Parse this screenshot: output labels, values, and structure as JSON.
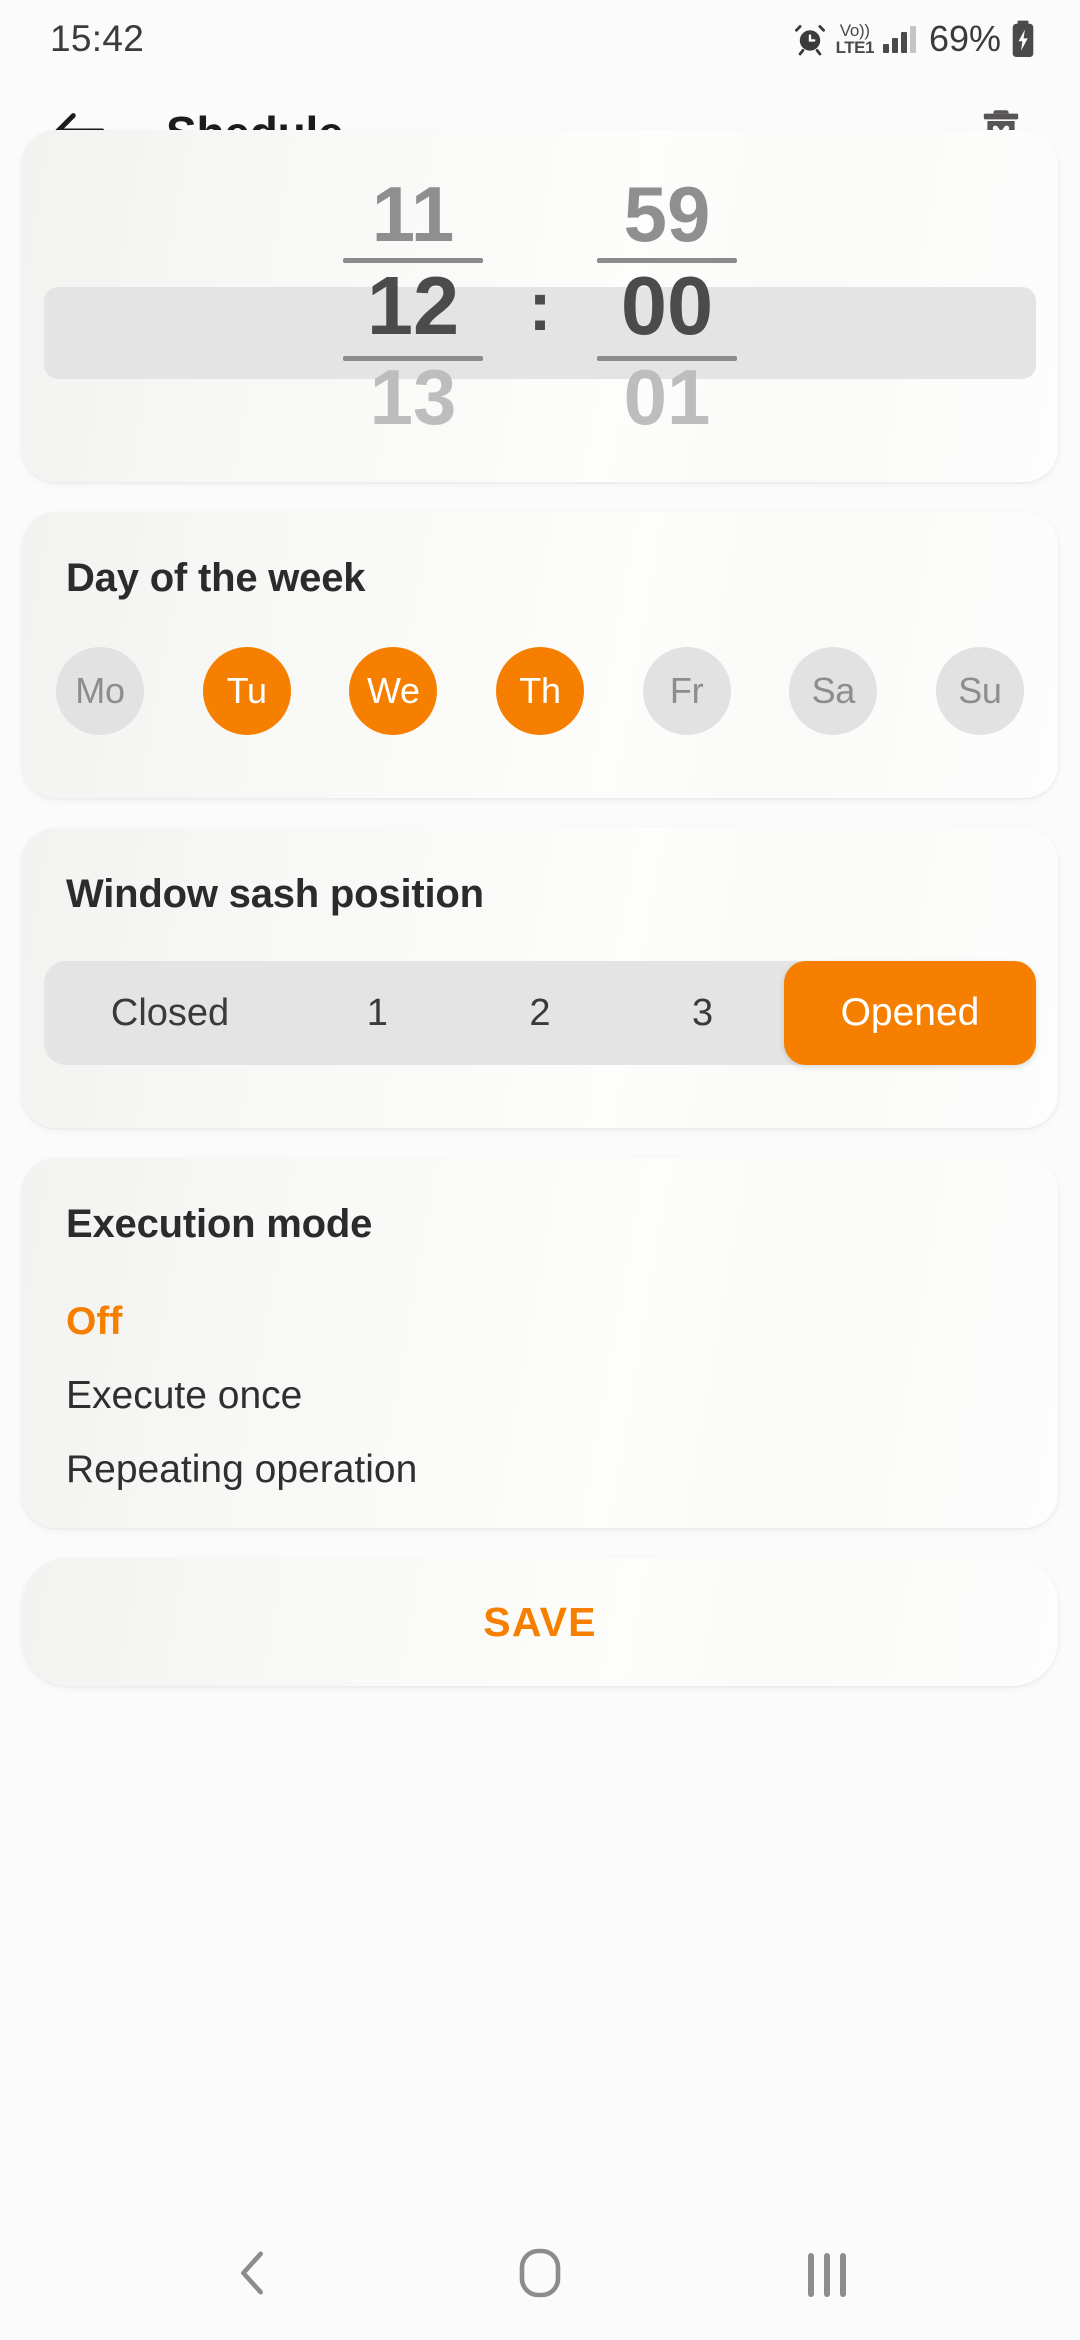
{
  "status_bar": {
    "time": "15:42",
    "alarm_icon": "alarm-clock-icon",
    "network": {
      "line1": "Vo))",
      "line2": "LTE1"
    },
    "signal_icon": "signal-bars-icon",
    "battery_percent": "69%",
    "battery_icon": "battery-charging-icon"
  },
  "app_bar": {
    "back_icon": "arrow-left-icon",
    "title": "Shedule",
    "delete_icon": "trash-delete-icon"
  },
  "time_picker": {
    "hour": {
      "prev": "11",
      "current": "12",
      "next": "13"
    },
    "separator": ":",
    "minute": {
      "prev": "59",
      "current": "00",
      "next": "01"
    }
  },
  "day_of_week": {
    "title": "Day of the week",
    "days": [
      {
        "label": "Mo",
        "selected": false
      },
      {
        "label": "Tu",
        "selected": true
      },
      {
        "label": "We",
        "selected": true
      },
      {
        "label": "Th",
        "selected": true
      },
      {
        "label": "Fr",
        "selected": false
      },
      {
        "label": "Sa",
        "selected": false
      },
      {
        "label": "Su",
        "selected": false
      }
    ]
  },
  "sash_position": {
    "title": "Window sash position",
    "options": [
      {
        "label": "Closed",
        "selected": false
      },
      {
        "label": "1",
        "selected": false
      },
      {
        "label": "2",
        "selected": false
      },
      {
        "label": "3",
        "selected": false
      },
      {
        "label": "Opened",
        "selected": true
      }
    ]
  },
  "execution_mode": {
    "title": "Execution mode",
    "options": [
      {
        "label": "Off",
        "selected": true
      },
      {
        "label": "Execute once",
        "selected": false
      },
      {
        "label": "Repeating operation",
        "selected": false
      }
    ]
  },
  "save_button": {
    "label": "SAVE"
  },
  "nav_bar": {
    "back_icon": "nav-back-icon",
    "home_icon": "nav-home-icon",
    "recents_icon": "nav-recents-icon"
  },
  "colors": {
    "accent": "#f77f00",
    "background": "#fbfbfb",
    "card": "#f7f7f5",
    "chip_inactive": "#e2e2e2",
    "text_primary": "#2b2b2b",
    "text_muted": "#8d8d8d"
  }
}
